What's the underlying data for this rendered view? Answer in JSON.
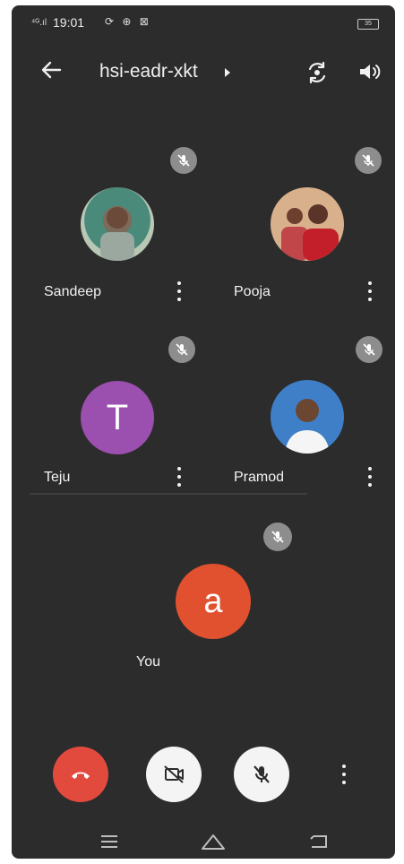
{
  "status_bar": {
    "signal": "⁴ᴳ.ıl",
    "time": "19:01",
    "icons": "⟳ ⊕ ⊠",
    "battery": "35"
  },
  "app_bar": {
    "title": "hsi-eadr-xkt",
    "back_icon": "arrow-left-icon",
    "flip_icon": "flip-camera-icon",
    "speaker_icon": "speaker-icon"
  },
  "participants": [
    {
      "name": "Sandeep",
      "avatar_type": "photo",
      "muted": true
    },
    {
      "name": "Pooja",
      "avatar_type": "photo",
      "muted": true
    },
    {
      "name": "Teju",
      "avatar_type": "letter",
      "letter": "T",
      "avatar_color": "#9b4fae",
      "muted": true
    },
    {
      "name": "Pramod",
      "avatar_type": "photo",
      "muted": true
    }
  ],
  "self": {
    "name": "You",
    "letter": "a",
    "avatar_color": "#e1512f",
    "muted": true
  },
  "controls": {
    "end_call_color": "#e24a3e",
    "camera": "camera-off",
    "mic": "mic-off"
  },
  "colors": {
    "background": "#2c2c2c",
    "mute_badge": "#8d8d8d"
  }
}
